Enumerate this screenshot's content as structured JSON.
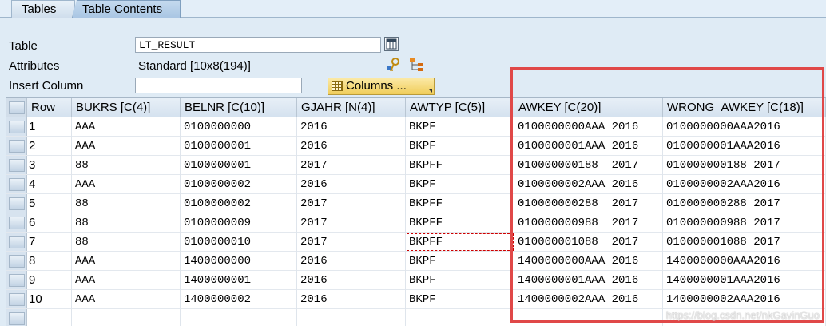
{
  "tabs": [
    {
      "label": "Tables"
    },
    {
      "label": "Table Contents",
      "active": true
    }
  ],
  "form": {
    "table_label": "Table",
    "table_value": "LT_RESULT",
    "attributes_label": "Attributes",
    "attributes_value": "Standard [10x8(194)]",
    "insert_column_label": "Insert Column",
    "insert_column_value": "",
    "columns_button": "Columns ..."
  },
  "table": {
    "headers": [
      "Row",
      "BUKRS [C(4)]",
      "BELNR [C(10)]",
      "GJAHR [N(4)]",
      "AWTYP [C(5)]",
      "AWKEY [C(20)]",
      "WRONG_AWKEY [C(18)]"
    ],
    "rows": [
      [
        "1",
        "AAA",
        "0100000000",
        "2016",
        "BKPF",
        "0100000000AAA 2016",
        "0100000000AAA2016"
      ],
      [
        "2",
        "AAA",
        "0100000001",
        "2016",
        "BKPF",
        "0100000001AAA 2016",
        "0100000001AAA2016"
      ],
      [
        "3",
        "88",
        "0100000001",
        "2017",
        "BKPFF",
        "010000000188  2017",
        "010000000188 2017"
      ],
      [
        "4",
        "AAA",
        "0100000002",
        "2016",
        "BKPF",
        "0100000002AAA 2016",
        "0100000002AAA2016"
      ],
      [
        "5",
        "88",
        "0100000002",
        "2017",
        "BKPFF",
        "010000000288  2017",
        "010000000288 2017"
      ],
      [
        "6",
        "88",
        "0100000009",
        "2017",
        "BKPFF",
        "010000000988  2017",
        "010000000988 2017"
      ],
      [
        "7",
        "88",
        "0100000010",
        "2017",
        "BKPFF",
        "010000001088  2017",
        "010000001088 2017"
      ],
      [
        "8",
        "AAA",
        "1400000000",
        "2016",
        "BKPF",
        "1400000000AAA 2016",
        "1400000000AAA2016"
      ],
      [
        "9",
        "AAA",
        "1400000001",
        "2016",
        "BKPF",
        "1400000001AAA 2016",
        "1400000001AAA2016"
      ],
      [
        "10",
        "AAA",
        "1400000002",
        "2016",
        "BKPF",
        "1400000002AAA 2016",
        "1400000002AAA2016"
      ]
    ]
  },
  "watermark": "https://blog.csdn.net/nkGavinGuo"
}
